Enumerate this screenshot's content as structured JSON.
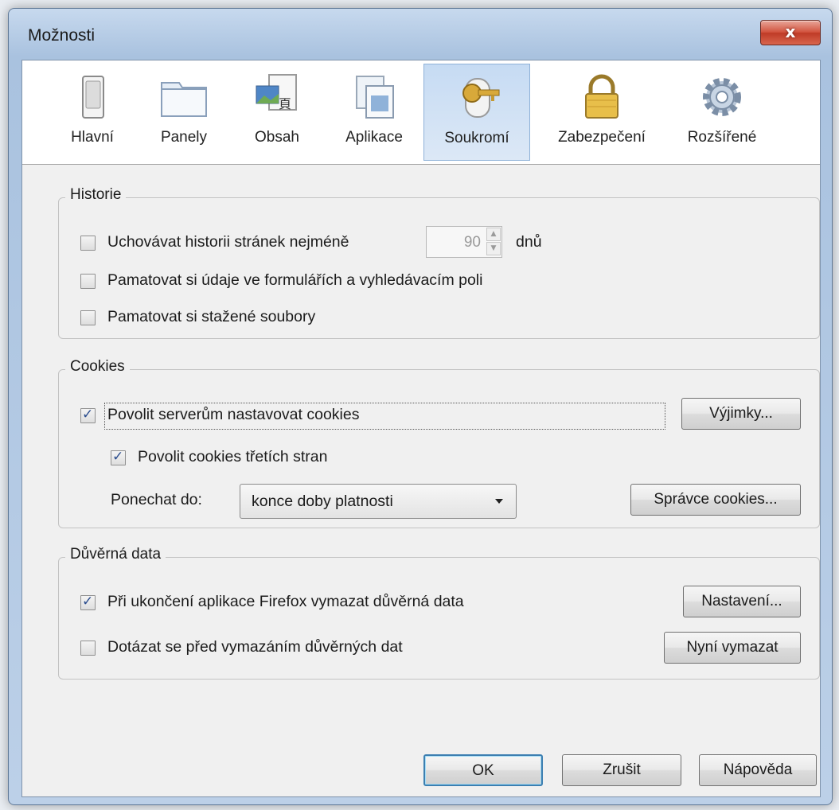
{
  "window": {
    "title": "Možnosti",
    "close_glyph": "x"
  },
  "toolbar": {
    "panes": [
      {
        "label": "Hlavní",
        "icon": "switch-icon"
      },
      {
        "label": "Panely",
        "icon": "tabs-icon"
      },
      {
        "label": "Obsah",
        "icon": "content-icon"
      },
      {
        "label": "Aplikace",
        "icon": "applications-icon"
      },
      {
        "label": "Soukromí",
        "icon": "privacy-key-icon",
        "active": true
      },
      {
        "label": "Zabezpečení",
        "icon": "padlock-icon"
      },
      {
        "label": "Rozšířené",
        "icon": "gear-icon"
      }
    ]
  },
  "history": {
    "title": "Historie",
    "keep_history_label": "Uchovávat historii stránek nejméně",
    "keep_history_checked": false,
    "days_value": "90",
    "days_unit": "dnů",
    "remember_forms_label": "Pamatovat si údaje ve formulářích a vyhledávacím poli",
    "remember_forms_checked": false,
    "remember_downloads_label": "Pamatovat si stažené soubory",
    "remember_downloads_checked": false
  },
  "cookies": {
    "title": "Cookies",
    "allow_cookies_label": "Povolit serverům nastavovat cookies",
    "allow_cookies_checked": true,
    "exceptions_button": "Výjimky...",
    "third_party_label": "Povolit cookies třetích stran",
    "third_party_checked": true,
    "keep_until_label": "Ponechat do:",
    "keep_until_value": "konce doby platnosti",
    "manager_button": "Správce cookies..."
  },
  "private_data": {
    "title": "Důvěrná data",
    "clear_on_exit_label": "Při ukončení aplikace Firefox vymazat důvěrná data",
    "clear_on_exit_checked": true,
    "settings_button": "Nastavení...",
    "ask_before_label": "Dotázat se před vymazáním důvěrných dat",
    "ask_before_checked": false,
    "clear_now_button": "Nyní vymazat"
  },
  "footer": {
    "ok_button": "OK",
    "cancel_button": "Zrušit",
    "help_button": "Nápověda"
  },
  "colors": {
    "active_pane": "#c6dbf3",
    "check_mark": "#2b4d8e",
    "close_button": "#c9462f",
    "default_button_border": "#3c7fb1"
  }
}
